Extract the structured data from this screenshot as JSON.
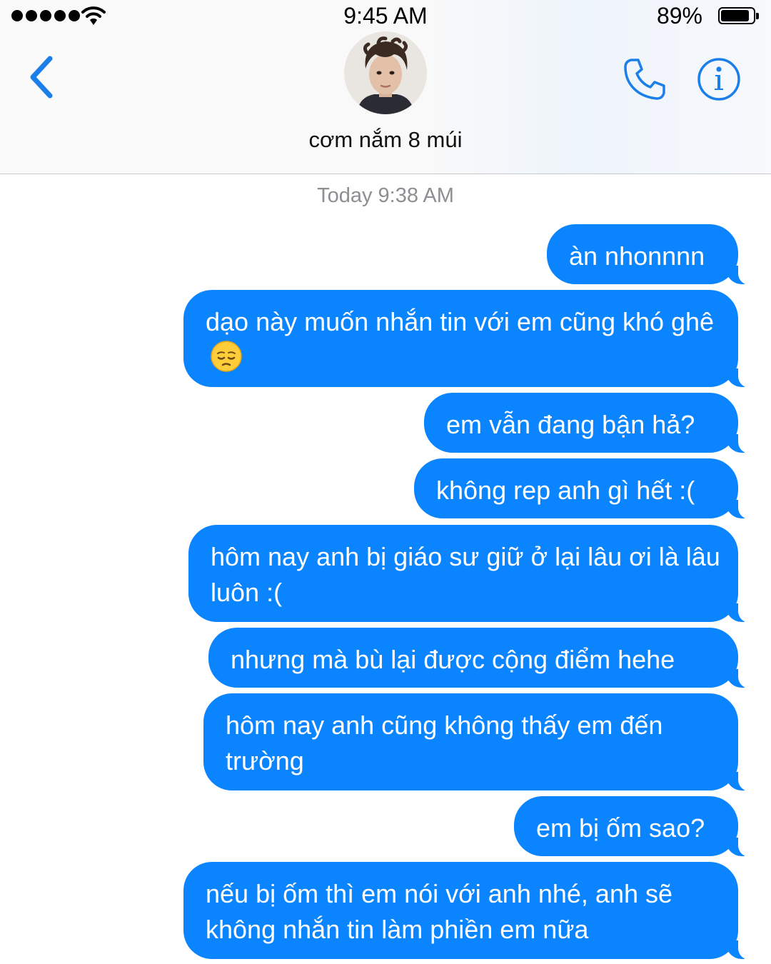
{
  "status_bar": {
    "time": "9:45 AM",
    "battery": "89%",
    "battery_level": 0.89
  },
  "header": {
    "contact_name": "cơm nắm 8 múi",
    "icons": [
      "back-chevron-icon",
      "avatar",
      "phone-icon",
      "info-icon"
    ]
  },
  "conversation": {
    "timestamp": "Today 9:38 AM",
    "messages": [
      {
        "text": "àn nhonnnn"
      },
      {
        "text": "dạo này muốn nhắn tin với em cũng khó ghê",
        "emoji": "pensive-face"
      },
      {
        "text": "em vẫn đang bận hả?"
      },
      {
        "text": "không rep anh gì hết :("
      },
      {
        "text": "hôm nay anh bị giáo sư giữ ở lại lâu ơi là lâu luôn :("
      },
      {
        "text": "nhưng mà bù lại được cộng điểm hehe"
      },
      {
        "text": "hôm nay anh cũng không thấy em đến trường"
      },
      {
        "text": "em bị ốm sao?"
      },
      {
        "text": "nếu bị ốm thì em nói với anh nhé, anh sẽ không nhắn tin làm phiền em nữa"
      }
    ]
  },
  "colors": {
    "bubble": "#0a84ff",
    "bubble_text": "#ffffff",
    "accent": "#1a7fe8"
  }
}
